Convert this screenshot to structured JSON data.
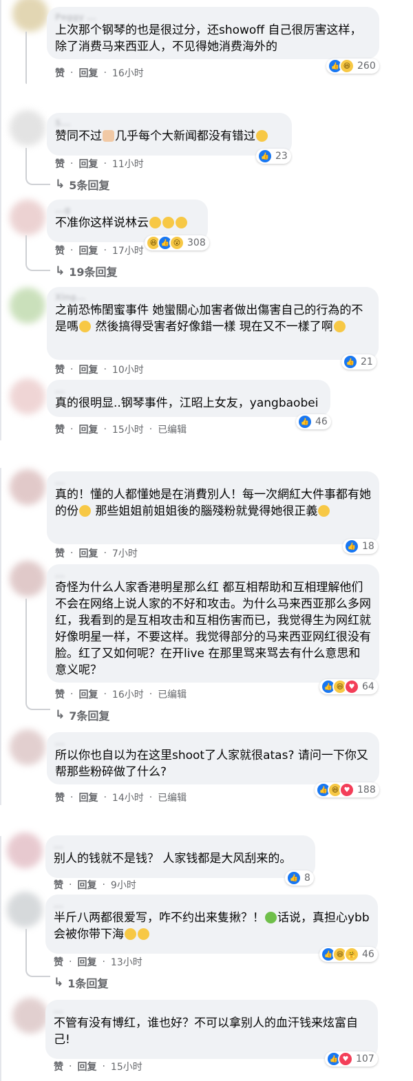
{
  "labels": {
    "like": "赞",
    "reply": "回复",
    "edited": "已编辑"
  },
  "comments": [
    {
      "name": "Peggy ...",
      "time": "16小时",
      "text_a": "上次那个钢琴的也是很过分，还showoff 自己很厉害这样，除了消费马来西亚人，不见得她消费海外的",
      "reactions": [
        "like",
        "haha"
      ],
      "count": "260"
    },
    {
      "name": "S...",
      "time": "11小时",
      "text_a": "赞同不过",
      "text_b": "几乎每个大新闻都没有错过",
      "reactions": [
        "like"
      ],
      "count": "23",
      "replies": "5条回复"
    },
    {
      "name": "...g",
      "time": "17小时",
      "text_a": "不准你这样说林云",
      "reactions": [
        "haha",
        "like",
        "wow"
      ],
      "count": "308",
      "replies": "19条回复"
    },
    {
      "name": "Xing...",
      "time": "10小时",
      "text_a": "之前恐怖閨蜜事件 她蠻關心加害者做出傷害自己的行為的不是嗎",
      "text_b": " 然後搞得受害者好像錯一樣 現在又不一樣了啊",
      "reactions": [
        "like"
      ],
      "count": "21"
    },
    {
      "name": "...",
      "time": "15小时",
      "edited": true,
      "text_a": "真的很明显..钢琴事件，江昭上女友，yangbaobei",
      "reactions": [
        "like"
      ],
      "count": "46"
    },
    {
      "name": "...",
      "time": "7小时",
      "text_a": "真的！懂的人都懂她是在消費別人！每一次網紅大件事都有她的份",
      "text_b": " 那些姐姐前姐姐後的腦殘粉就覺得她很正義",
      "reactions": [
        "like"
      ],
      "count": "18"
    },
    {
      "name": "...",
      "time": "16小时",
      "edited": true,
      "text_a": "奇怪为什么人家香港明星那么红 都互相帮助和互相理解他们不会在网络上说人家的不好和攻击。为什么马来西亚那么多网红，我看到的是互相攻击和互相伤害而已，我觉得生为网红就好像明星一样，不要这样。我觉得部分的马来西亚网红很没有脸。红了又如何呢？在开live 在那里骂来骂去有什么意思和意义呢？",
      "reactions": [
        "like",
        "haha",
        "love"
      ],
      "count": "64",
      "replies": "7条回复"
    },
    {
      "name": "...",
      "time": "14小时",
      "edited": true,
      "text_a": "所以你也自以为在这里shoot了人家就很atas? 请问一下你又帮那些粉碎做了什么?",
      "reactions": [
        "like",
        "haha",
        "love"
      ],
      "count": "188"
    },
    {
      "name": "...",
      "time": "9小时",
      "text_a": "别人的钱就不是钱？ 人家钱都是大风刮来的。",
      "reactions": [
        "like"
      ],
      "count": "8"
    },
    {
      "name": "...",
      "time": "13小时",
      "text_a": "半斤八两都很爱写，咋不约出来隻揪？！",
      "text_b": "话说，真担心ybb会被你带下海",
      "reactions": [
        "like",
        "haha",
        "care"
      ],
      "count": "46",
      "replies": "1条回复"
    },
    {
      "name": "...",
      "time": "15小时",
      "text_a": "不管有没有博红，谁也好？不可以拿别人的血汗钱来炫富自己!",
      "reactions": [
        "like",
        "love"
      ],
      "count": "107"
    }
  ],
  "colors": {
    "like_blue": "#1877f2",
    "love_red": "#f33e58",
    "haha_yellow": "#f7c845",
    "bubble_bg": "#f0f2f5",
    "meta_gray": "#65676b"
  }
}
